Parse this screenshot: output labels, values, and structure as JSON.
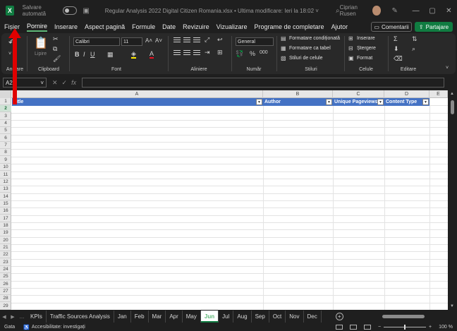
{
  "titlebar": {
    "logo_letter": "X",
    "autosave_label": "Salvare automată",
    "doc_title": "Regular Analysis 2022 Digital Citizen Romania.xlsx • Ultima modificare: Ieri la 18:02 ˅",
    "user_name": "Ciprian Rusen",
    "minimize": "—",
    "maximize": "▢",
    "close": "✕"
  },
  "menu": {
    "tabs": [
      "Fișier",
      "Pornire",
      "Inserare",
      "Aspect pagină",
      "Formule",
      "Date",
      "Revizuire",
      "Vizualizare",
      "Programe de completare",
      "Ajutor"
    ],
    "active_tab": "Pornire",
    "comments_label": "Comentarii",
    "share_label": "Partajare"
  },
  "ribbon": {
    "groups": {
      "undo": "Anulare",
      "clipboard": "Clipboard",
      "font": "Font",
      "alignment": "Aliniere",
      "number": "Număr",
      "styles": "Stiluri",
      "cells": "Celule",
      "editing": "Editare"
    },
    "paste_label": "Lipire",
    "font_name": "Calibri",
    "font_size": "11",
    "number_format": "General",
    "conditional_formatting": "Formatare condiționată",
    "format_as_table": "Formatare ca tabel",
    "cell_styles": "Stiluri de celule",
    "insert_label": "Inserare",
    "delete_label": "Ștergere",
    "format_label": "Format"
  },
  "formula_bar": {
    "cell_ref": "A2",
    "formula": ""
  },
  "grid": {
    "columns": [
      "A",
      "B",
      "C",
      "D",
      "E"
    ],
    "table_headers": [
      "Title",
      "Author",
      "Unique Pageviews",
      "Content Type"
    ],
    "row_numbers": [
      "1",
      "2",
      "3",
      "4",
      "5",
      "6",
      "7",
      "8",
      "9",
      "10",
      "11",
      "12",
      "13",
      "14",
      "15",
      "16",
      "17",
      "18",
      "19",
      "20",
      "21",
      "22",
      "23",
      "24",
      "25",
      "26",
      "27",
      "28",
      "29"
    ],
    "selected_row": "2"
  },
  "sheets": {
    "tabs": [
      "KPIs",
      "Traffic Sources Analysis",
      "Jan",
      "Feb",
      "Mar",
      "Apr",
      "May",
      "Jun",
      "Jul",
      "Aug",
      "Sep",
      "Oct",
      "Nov",
      "Dec"
    ],
    "active": "Jun",
    "dots": "..."
  },
  "status": {
    "ready": "Gata",
    "accessibility": "Accesibilitate: investigați",
    "zoom": "100 %"
  }
}
